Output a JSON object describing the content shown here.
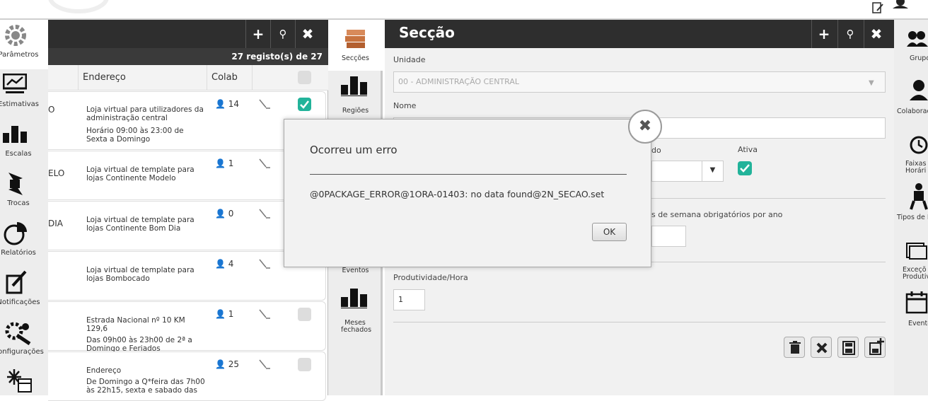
{
  "nav_left": [
    {
      "label": "Parâmetros",
      "icon": "gear-icon"
    },
    {
      "label": "Estimativas",
      "icon": "trend-chart-icon"
    },
    {
      "label": "Escalas",
      "icon": "bar-chart-icon"
    },
    {
      "label": "Trocas",
      "icon": "swap-arrows-icon"
    },
    {
      "label": "Relatórios",
      "icon": "pie-chart-icon"
    },
    {
      "label": "Notificações",
      "icon": "edit-note-icon"
    },
    {
      "label": "Configurações",
      "icon": "wrench-gear-icon"
    },
    {
      "label": "",
      "icon": "sparkle-calendar-icon"
    }
  ],
  "list": {
    "count_text": "27 registo(s) de 27",
    "columns": {
      "address": "Endereço",
      "colab": "Colab"
    },
    "rows": [
      {
        "name": "O",
        "address": "Loja virtual para utilizadores da administração central",
        "address2": "Horário 09:00 às 23:00 de Sexta a Domingo",
        "colab": "14",
        "checked": true
      },
      {
        "name": "ELO",
        "address": "Loja virtual de template para lojas Continente Modelo",
        "address2": "",
        "colab": "1",
        "checked": false
      },
      {
        "name": "DIA",
        "address": "Loja virtual de template para lojas Continente Bom Dia",
        "address2": "",
        "colab": "0",
        "checked": false
      },
      {
        "name": "",
        "address": "Loja virtual de template para lojas Bombocado",
        "address2": "",
        "colab": "4",
        "checked": false
      },
      {
        "name": "",
        "address": "Estrada Nacional nº 10 KM 129,6",
        "address2": "Das 09h00 às 23h00 de 2ª a Domingo e Feriados",
        "colab": "1",
        "checked": false
      },
      {
        "name": "",
        "address": "Endereço",
        "address2": "De Domingo a Q*feira das 7h00 às 22h15, sexta e sabado das",
        "colab": "25",
        "checked": false
      }
    ]
  },
  "nav_mid": [
    {
      "label": "Secções",
      "icon": "boxes-icon"
    },
    {
      "label": "Regiões",
      "icon": "bar-chart-icon"
    },
    {
      "label": "Eventos",
      "icon": "event-icon"
    },
    {
      "label": "Meses fechados",
      "icon": "bar-chart-icon"
    }
  ],
  "form": {
    "title": "Secção",
    "unidade_label": "Unidade",
    "unidade_value": "00 - ADMINISTRAÇÃO CENTRAL",
    "nome_label": "Nome",
    "partial_label": "do",
    "ativa_label": "Ativa",
    "fds_label": "s de semana obrigatórios por ano",
    "prod_label": "Produtividade/Hora",
    "prod_value": "1"
  },
  "nav_right": [
    {
      "label": "Grupo",
      "icon": "group-icon"
    },
    {
      "label": "Colaborad",
      "icon": "person-icon"
    },
    {
      "label": "Faixas Horári",
      "icon": "clock-icon"
    },
    {
      "label": "Tipos de F",
      "icon": "worker-icon"
    },
    {
      "label": "Exceçõ Produtivi",
      "icon": "exception-icon"
    },
    {
      "label": "Evento",
      "icon": "calendar-icon"
    }
  ],
  "modal": {
    "title": "Ocorreu um erro",
    "message": "@0PACKAGE_ERROR@1ORA-01403: no data found@2N_SECAO.set",
    "ok": "OK"
  },
  "colors": {
    "accent": "#22b39a",
    "header": "#2e2e2e"
  }
}
